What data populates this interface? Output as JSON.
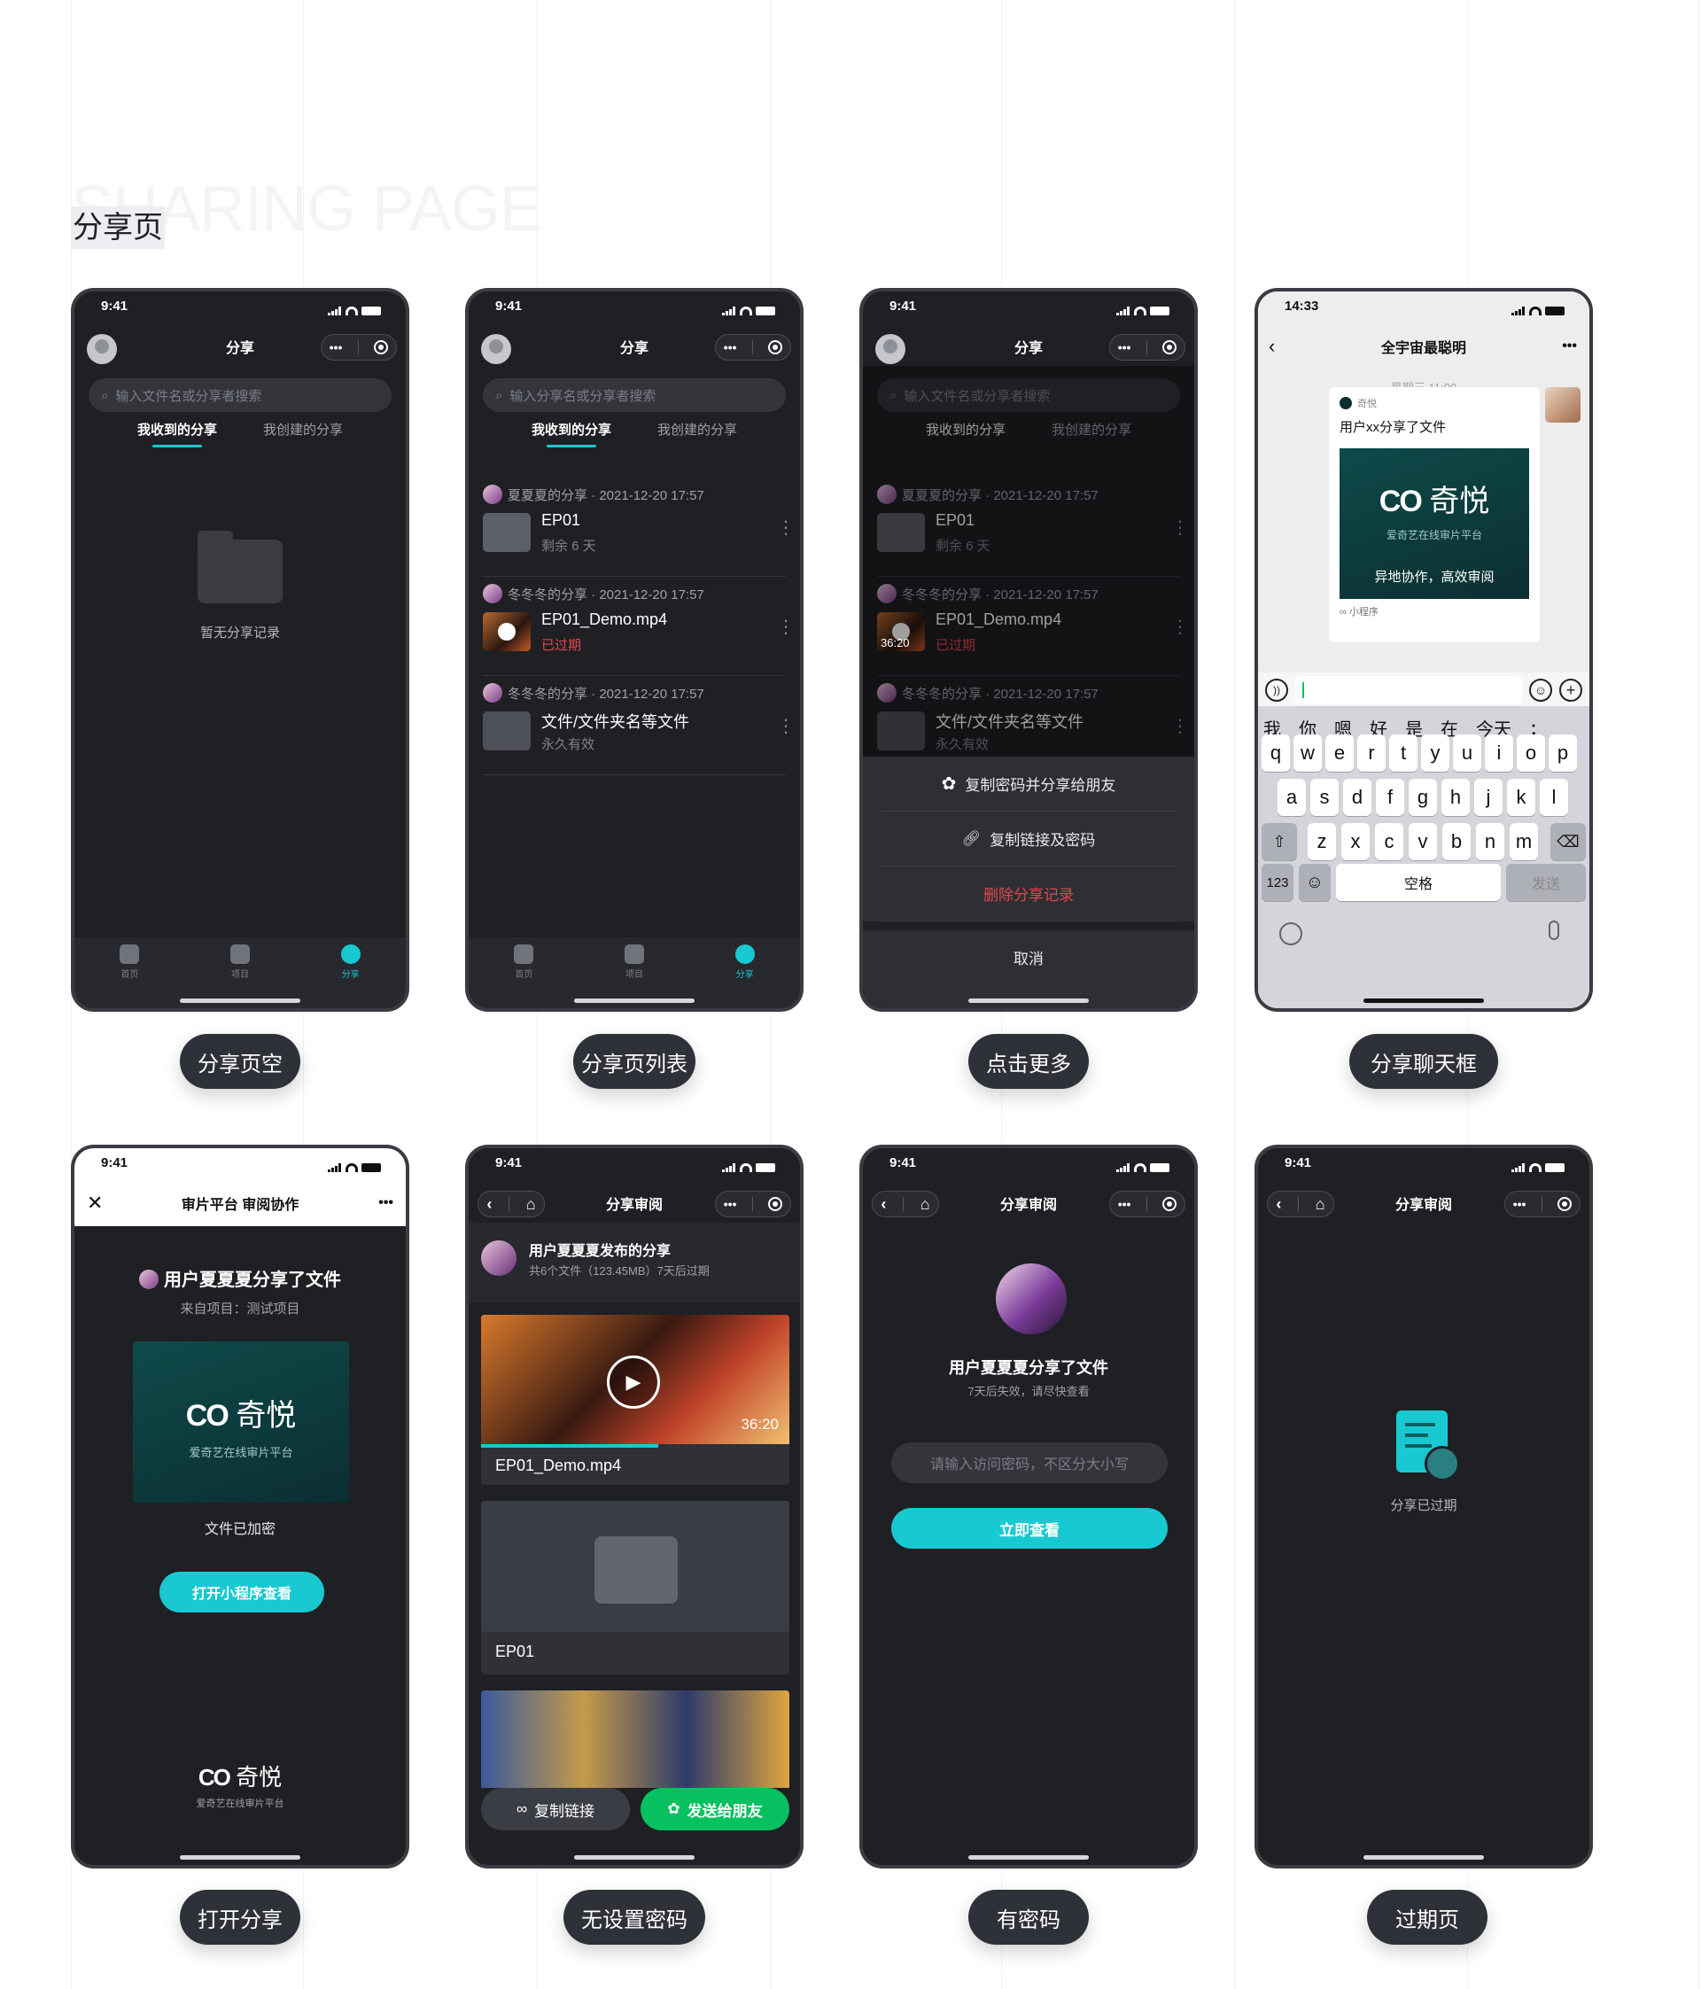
{
  "header": {
    "title_en": "SHARING PAGE",
    "title_zh": "分享页"
  },
  "status_time": "9:41",
  "phones": {
    "p1": {
      "title": "分享",
      "search_placeholder": "输入文件名或分享者搜索",
      "tab_received": "我收到的分享",
      "tab_created": "我创建的分享",
      "empty_text": "暂无分享记录",
      "tab_home": "首页",
      "tab_project": "项目",
      "tab_share": "分享",
      "caption": "分享页空"
    },
    "p2": {
      "title": "分享",
      "search_placeholder": "输入分享名或分享者搜索",
      "tab_received": "我收到的分享",
      "tab_created": "我创建的分享",
      "items": [
        {
          "who": "夏夏夏的分享 · 2021-12-20 17:57",
          "name": "EP01",
          "sub": "剩余 6 天"
        },
        {
          "who": "冬冬冬的分享 · 2021-12-20 17:57",
          "name": "EP01_Demo.mp4",
          "sub": "已过期"
        },
        {
          "who": "冬冬冬的分享 · 2021-12-20 17:57",
          "name": "文件/文件夹名等文件",
          "sub": "永久有效"
        }
      ],
      "tab_home": "首页",
      "tab_project": "项目",
      "tab_share": "分享",
      "caption": "分享页列表"
    },
    "p3": {
      "title": "分享",
      "search_placeholder": "输入文件名或分享者搜索",
      "tab_received": "我收到的分享",
      "tab_created": "我创建的分享",
      "items": [
        {
          "who": "夏夏夏的分享 · 2021-12-20 17:57",
          "name": "EP01",
          "sub": "剩余 6 天"
        },
        {
          "who": "冬冬冬的分享 · 2021-12-20 17:57",
          "name": "EP01_Demo.mp4",
          "sub": "已过期",
          "duration": "36:20"
        },
        {
          "who": "冬冬冬的分享 · 2021-12-20 17:57",
          "name": "文件/文件夹名等文件",
          "sub": "永久有效"
        }
      ],
      "sheet": {
        "copy_pwd": "复制密码并分享给朋友",
        "copy_link": "复制链接及密码",
        "delete": "删除分享记录",
        "cancel": "取消"
      },
      "caption": "点击更多"
    },
    "p4": {
      "time": "14:33",
      "title": "全宇宙最聪明",
      "date": "星期三 11:00",
      "card_source": "奇悦",
      "card_title": "用户xx分享了文件",
      "brand": "奇悦",
      "brand_sub": "爱奇艺在线审片平台",
      "brand_slogan": "异地协作，高效审阅",
      "mini": "小程序",
      "kb_cands": [
        "我",
        "你",
        "嗯",
        "好",
        "是",
        "在",
        "今天",
        "；"
      ],
      "row1": [
        "q",
        "w",
        "e",
        "r",
        "t",
        "y",
        "u",
        "i",
        "o",
        "p"
      ],
      "row2": [
        "a",
        "s",
        "d",
        "f",
        "g",
        "h",
        "j",
        "k",
        "l"
      ],
      "row3": [
        "z",
        "x",
        "c",
        "v",
        "b",
        "n",
        "m"
      ],
      "key_123": "123",
      "key_space": "空格",
      "key_send": "发送",
      "caption": "分享聊天框"
    },
    "p5": {
      "title": "审片平台 审阅协作",
      "share_title": "用户夏夏夏分享了文件",
      "from": "来自项目：测试项目",
      "brand": "奇悦",
      "brand_sub": "爱奇艺在线审片平台",
      "encrypted": "文件已加密",
      "open_btn": "打开小程序查看",
      "caption": "打开分享"
    },
    "p6": {
      "title": "分享审阅",
      "publisher": "用户夏夏夏发布的分享",
      "meta": "共6个文件（123.45MB）7天后过期",
      "video_name": "EP01_Demo.mp4",
      "duration": "36:20",
      "folder_name": "EP01",
      "copy_btn": "复制链接",
      "send_btn": "发送给朋友",
      "caption": "无设置密码"
    },
    "p7": {
      "title": "分享审阅",
      "share_title": "用户夏夏夏分享了文件",
      "expire_note": "7天后失效，请尽快查看",
      "pwd_placeholder": "请输入访问密码，不区分大小写",
      "view_btn": "立即查看",
      "caption": "有密码"
    },
    "p8": {
      "title": "分享审阅",
      "expired": "分享已过期",
      "caption": "过期页"
    }
  },
  "colors": {
    "accent": "#19c9d1",
    "danger": "#e2474b",
    "wechat_green": "#07c160",
    "phone_bg": "#1f2024"
  }
}
